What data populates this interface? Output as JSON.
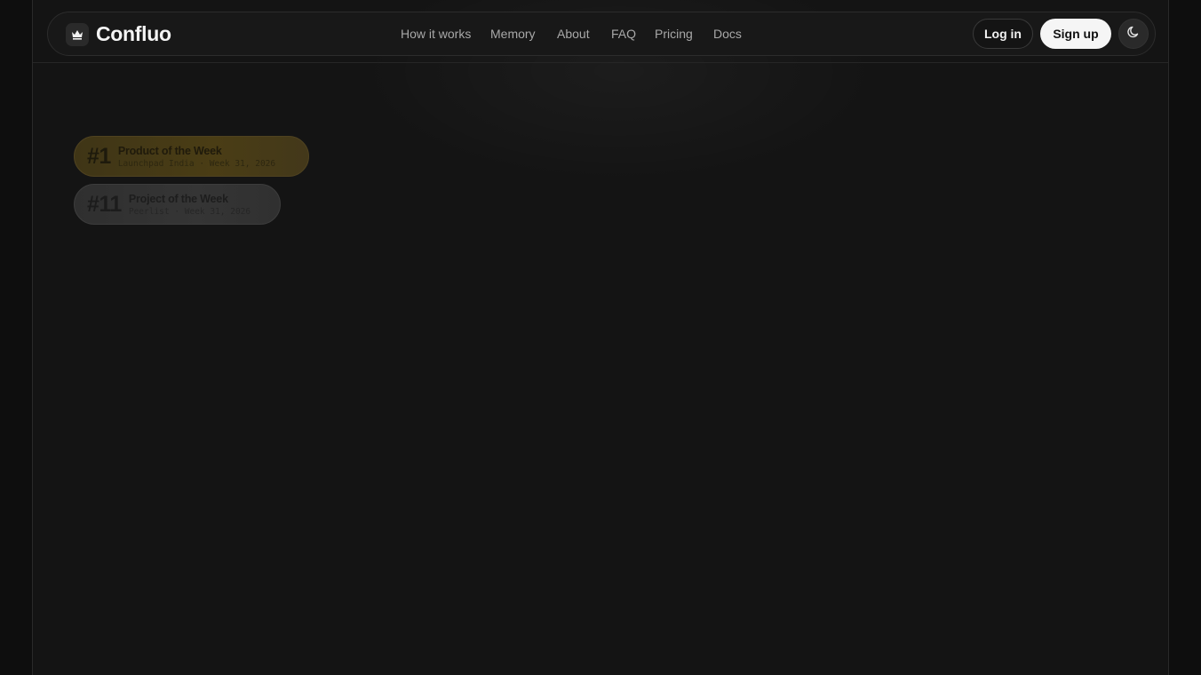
{
  "brand": {
    "name": "Confluo",
    "logo_icon": "crown-icon"
  },
  "nav": {
    "links": [
      {
        "label": "How it works"
      },
      {
        "label": "Memory"
      },
      {
        "label": "About"
      },
      {
        "label": "FAQ"
      },
      {
        "label": "Pricing"
      },
      {
        "label": "Docs"
      }
    ]
  },
  "actions": {
    "login_label": "Log in",
    "signup_label": "Sign up",
    "theme_icon": "moon-icon"
  },
  "badges": [
    {
      "rank": "#1",
      "title": "Product of the Week",
      "subtitle": "Launchpad India · Week 31, 2026",
      "accent": "#4a3d15"
    },
    {
      "rank": "#11",
      "title": "Project of the Week",
      "subtitle": "Peerlist · Week 31, 2026",
      "accent": "#353535"
    }
  ],
  "colors": {
    "background": "#141414",
    "outer": "#0e0e0e",
    "signup_bg": "#f5f5f5"
  }
}
